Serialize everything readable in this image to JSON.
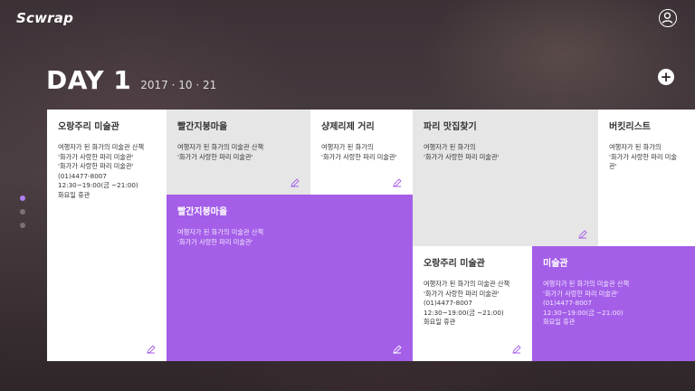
{
  "app": {
    "title": "Scwrap"
  },
  "header": {
    "day_title": "DAY 1",
    "date": "2017 · 10 · 21",
    "add_label": "+"
  },
  "cards": [
    {
      "title": "오랑주리 미술관",
      "desc": "여행자가 된 화가의 미술관 산책\n'화가가 사랑한 파리 미술관'\n'화가가 사랑한 파리 미술관'\n(01)4477-8007\n12:30~19:00(금 ~21:00)\n화요일 휴관"
    },
    {
      "title": "빨간지붕마을",
      "desc": "여행자가 된 화가의 미술관 산책\n'화가가 사랑한 파리 미술관'"
    },
    {
      "title": "샹제리제 거리",
      "desc": "여행자가 된 화가의\n'화가가 사랑한 파리 미술관'"
    },
    {
      "title": "파리 맛집찾기",
      "desc": "여행자가 된 화가의\n'화가가 사랑한 파리 미술관'"
    },
    {
      "title": "버킷리스트",
      "desc": "여행자가 된 화가의\n'화가가 사랑한 파리 미술관'"
    },
    {
      "title": "빨간지붕마을",
      "desc": "여행자가 된 화가의 미술관 산책\n'화가가 사랑한 파리 미술관'"
    },
    {
      "title": "오랑주리 미술관",
      "desc": "여행자가 된 화가의 미술관 산책\n'화가가 사랑한 파리 미술관'\n(01)4477-8007\n12:30~19:00(금 ~21:00)\n화요일 휴관"
    },
    {
      "title": "미술관",
      "desc": "여행자가 된 화가의 미술관 산책\n'화가가 사랑한 파리 미술관'\n(01)4477-8007\n12:30~19:00(금 ~21:00)\n화요일 휴관"
    }
  ],
  "colors": {
    "accent": "#a45ee8",
    "gray_card": "#e6e6e6",
    "white_card": "#ffffff"
  }
}
